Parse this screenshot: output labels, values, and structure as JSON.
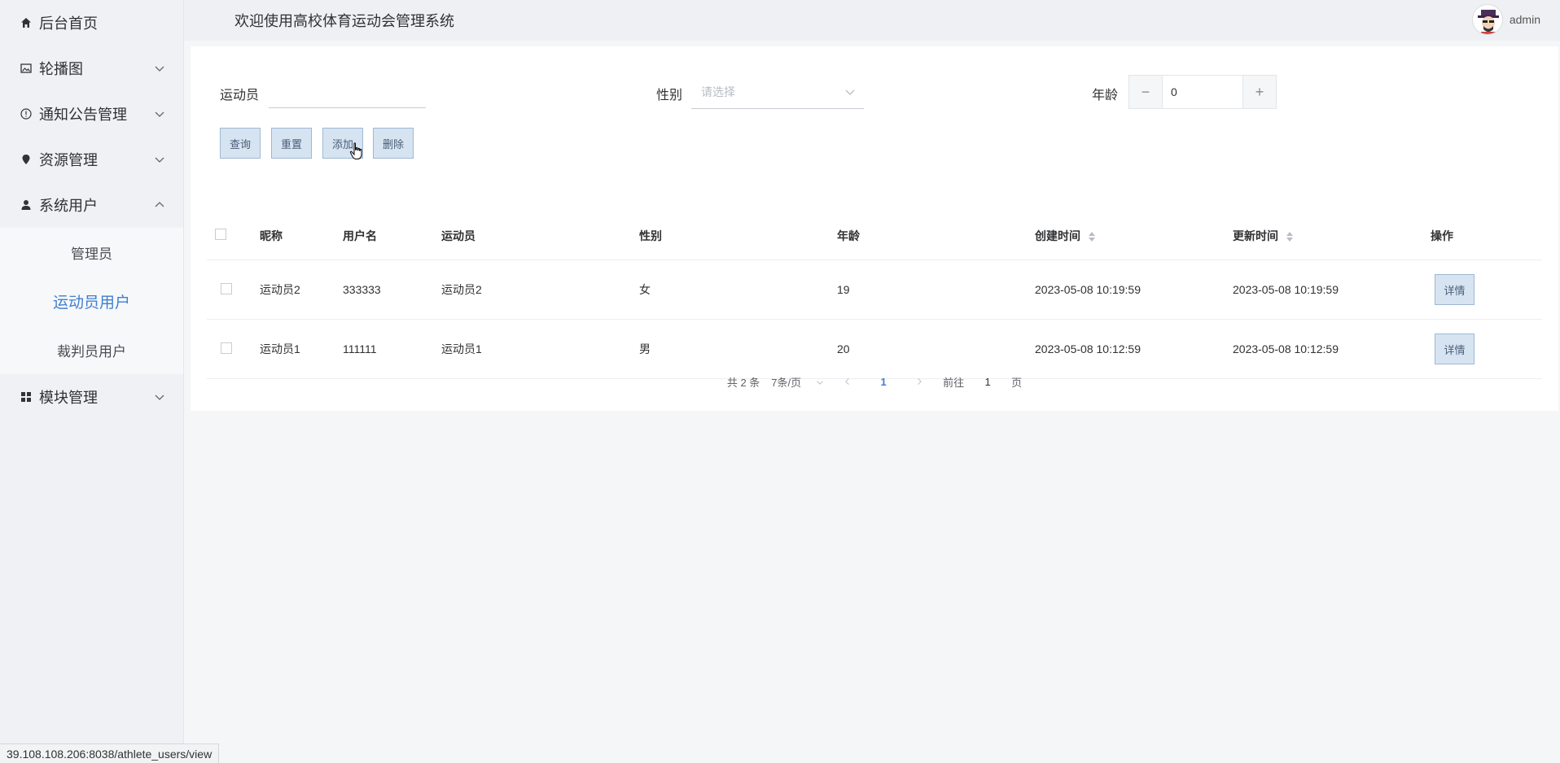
{
  "header": {
    "title": "欢迎使用高校体育运动会管理系统",
    "user_name": "admin"
  },
  "sidebar": {
    "items": [
      {
        "label": "后台首页"
      },
      {
        "label": "轮播图"
      },
      {
        "label": "通知公告管理"
      },
      {
        "label": "资源管理"
      },
      {
        "label": "系统用户"
      },
      {
        "label": "模块管理"
      }
    ],
    "sub_items": [
      {
        "label": "管理员"
      },
      {
        "label": "运动员用户"
      },
      {
        "label": "裁判员用户"
      }
    ]
  },
  "filters": {
    "athlete_label": "运动员",
    "athlete_value": "",
    "gender_label": "性别",
    "gender_placeholder": "请选择",
    "age_label": "年龄",
    "age_value": "0",
    "minus": "−",
    "plus": "+"
  },
  "buttons": {
    "query": "查询",
    "reset": "重置",
    "add": "添加",
    "delete": "删除"
  },
  "table": {
    "headers": {
      "nickname": "昵称",
      "username": "用户名",
      "athlete": "运动员",
      "gender": "性别",
      "age": "年龄",
      "created": "创建时间",
      "updated": "更新时间",
      "actions": "操作"
    },
    "rows": [
      {
        "nickname": "运动员2",
        "username": "333333",
        "athlete": "运动员2",
        "gender": "女",
        "age": "19",
        "created": "2023-05-08 10:19:59",
        "updated": "2023-05-08 10:19:59",
        "action": "详情"
      },
      {
        "nickname": "运动员1",
        "username": "111111",
        "athlete": "运动员1",
        "gender": "男",
        "age": "20",
        "created": "2023-05-08 10:12:59",
        "updated": "2023-05-08 10:12:59",
        "action": "详情"
      }
    ]
  },
  "pagination": {
    "total": "共 2 条",
    "page_size": "7条/页",
    "current_page": "1",
    "goto_label": "前往",
    "goto_value": "1",
    "page_suffix": "页"
  },
  "status_bar": {
    "url": "39.108.108.206:8038/athlete_users/view"
  },
  "colors": {
    "accent": "#3f7fd0",
    "button_bg": "#d6e4f2",
    "sidebar_bg": "#f0f1f4"
  }
}
